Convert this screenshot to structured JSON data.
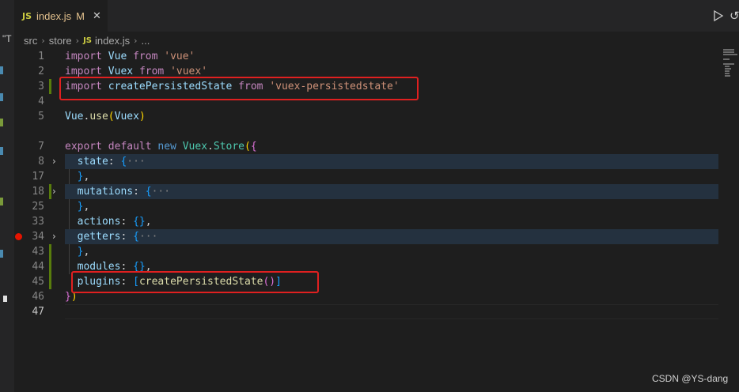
{
  "window": {
    "left_fragment": "\"T"
  },
  "tab": {
    "icon": "JS",
    "filename": "index.js",
    "modified": "M",
    "close": "✕"
  },
  "toolbar": {
    "run_icon": "play-icon",
    "undo_icon": "undo-icon"
  },
  "breadcrumb": {
    "parts": [
      "src",
      "store",
      "index.js",
      "..."
    ],
    "separator": "›",
    "js_icon": "JS"
  },
  "editor": {
    "lines": [
      {
        "num": "1"
      },
      {
        "num": "2"
      },
      {
        "num": "3"
      },
      {
        "num": "4"
      },
      {
        "num": "5"
      },
      {
        "num": "7"
      },
      {
        "num": "8"
      },
      {
        "num": "17"
      },
      {
        "num": "18"
      },
      {
        "num": "25"
      },
      {
        "num": "33"
      },
      {
        "num": "34"
      },
      {
        "num": "43"
      },
      {
        "num": "44"
      },
      {
        "num": "45"
      },
      {
        "num": "46"
      },
      {
        "num": "47"
      }
    ],
    "tokens": {
      "import": "import",
      "from": "from",
      "vue_id": "Vue",
      "vue_str": "'vue'",
      "vuex_id": "Vuex",
      "vuex_str": "'vuex'",
      "cps_id": "createPersistedState",
      "cps_str": "'vuex-persistedstate'",
      "use": "use",
      "export": "export",
      "default": "default",
      "new": "new",
      "store": "Store",
      "state": "state",
      "mutations": "mutations",
      "actions": "actions",
      "getters": "getters",
      "modules": "modules",
      "plugins": "plugins",
      "ellipsis": "···",
      "empty_obj": "{}"
    }
  },
  "watermark": "CSDN @YS-dang",
  "colors": {
    "annotation": "#e02020",
    "breakpoint": "#e51400",
    "git_modified": "#587c0c"
  }
}
